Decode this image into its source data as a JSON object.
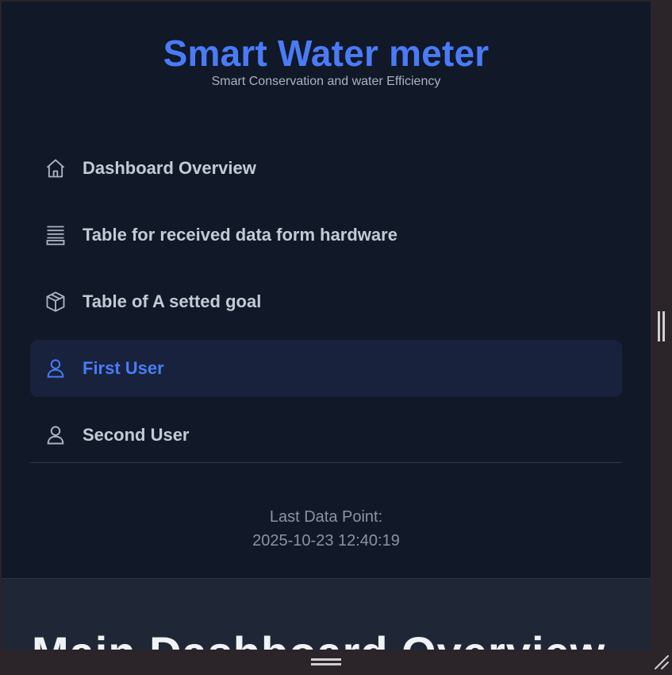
{
  "brand": {
    "title": "Smart Water meter",
    "subtitle": "Smart Conservation and water Efficiency"
  },
  "nav": {
    "items": [
      {
        "label": "Dashboard Overview",
        "icon": "home-icon",
        "active": false
      },
      {
        "label": "Table for received data form hardware",
        "icon": "database-icon",
        "active": false
      },
      {
        "label": "Table of A setted goal",
        "icon": "box-icon",
        "active": false
      },
      {
        "label": "First User",
        "icon": "user-icon",
        "active": true
      },
      {
        "label": "Second User",
        "icon": "user-icon",
        "active": false
      }
    ]
  },
  "status": {
    "last_data_label": "Last Data Point:",
    "last_data_value": "2025-10-23 12:40:19"
  },
  "main": {
    "title": "Main Dashboard Overview"
  },
  "colors": {
    "accent": "#4a7bf7",
    "sidebar_bg": "#111827",
    "active_bg": "#18223c",
    "main_bg": "#1f2737"
  }
}
